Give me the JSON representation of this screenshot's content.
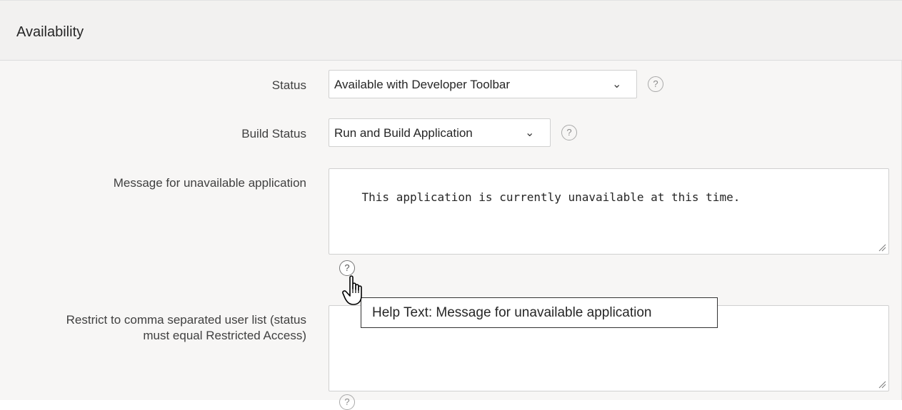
{
  "region": {
    "title": "Availability"
  },
  "fields": {
    "status": {
      "label": "Status",
      "value": "Available with Developer Toolbar",
      "help": "?"
    },
    "build_status": {
      "label": "Build Status",
      "value": "Run and Build Application",
      "help": "?"
    },
    "unavailable_message": {
      "label": "Message for unavailable application",
      "value": "This application is currently unavailable at this time.",
      "help": "?"
    },
    "restrict_users": {
      "label_line1": "Restrict to comma separated user list (status",
      "label_line2": "must equal Restricted Access)",
      "value": "",
      "help": "?"
    }
  },
  "tooltip": {
    "text": "Help Text: Message for unavailable application"
  },
  "icons": {
    "caret": "chevron-down-icon",
    "help": "help-icon",
    "cursor": "hand-pointer-icon",
    "resize": "resize-handle-icon"
  },
  "colors": {
    "region_bg": "#f7f6f5",
    "header_bg": "#f2f1f0",
    "border": "#d0d0d0",
    "tooltip_border": "#333333"
  }
}
